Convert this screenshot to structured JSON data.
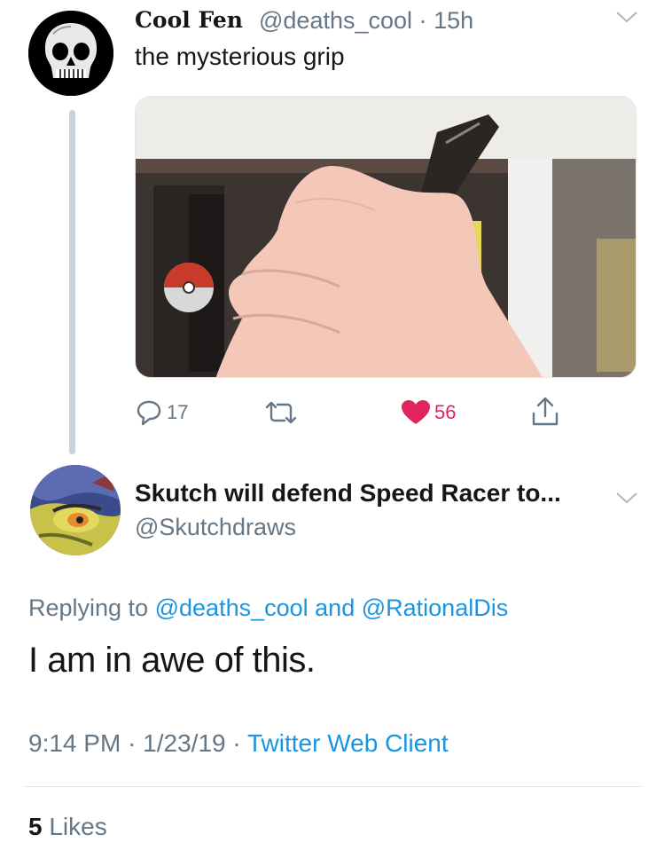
{
  "tweet1": {
    "display_name": "Cool Fen",
    "handle": "@deaths_cool",
    "separator": "·",
    "age": "15h",
    "text": "the mysterious grip",
    "reply_count": "17",
    "like_count": "56",
    "like_color": "#e0245e"
  },
  "tweet2": {
    "display_name": "Skutch will defend Speed Racer to...",
    "handle": "@Skutchdraws",
    "replying_prefix": "Replying to",
    "replying_user1": "@deaths_cool",
    "replying_and": "and",
    "replying_user2": "@RationalDis",
    "text": "I am in awe of this.",
    "time": "9:14 PM",
    "separator": "·",
    "date": "1/23/19",
    "client": "Twitter Web Client",
    "likes_count": "5",
    "likes_label": "Likes"
  },
  "colors": {
    "link": "#1b95e0",
    "secondary_text": "#657786",
    "primary_text": "#14171a"
  }
}
